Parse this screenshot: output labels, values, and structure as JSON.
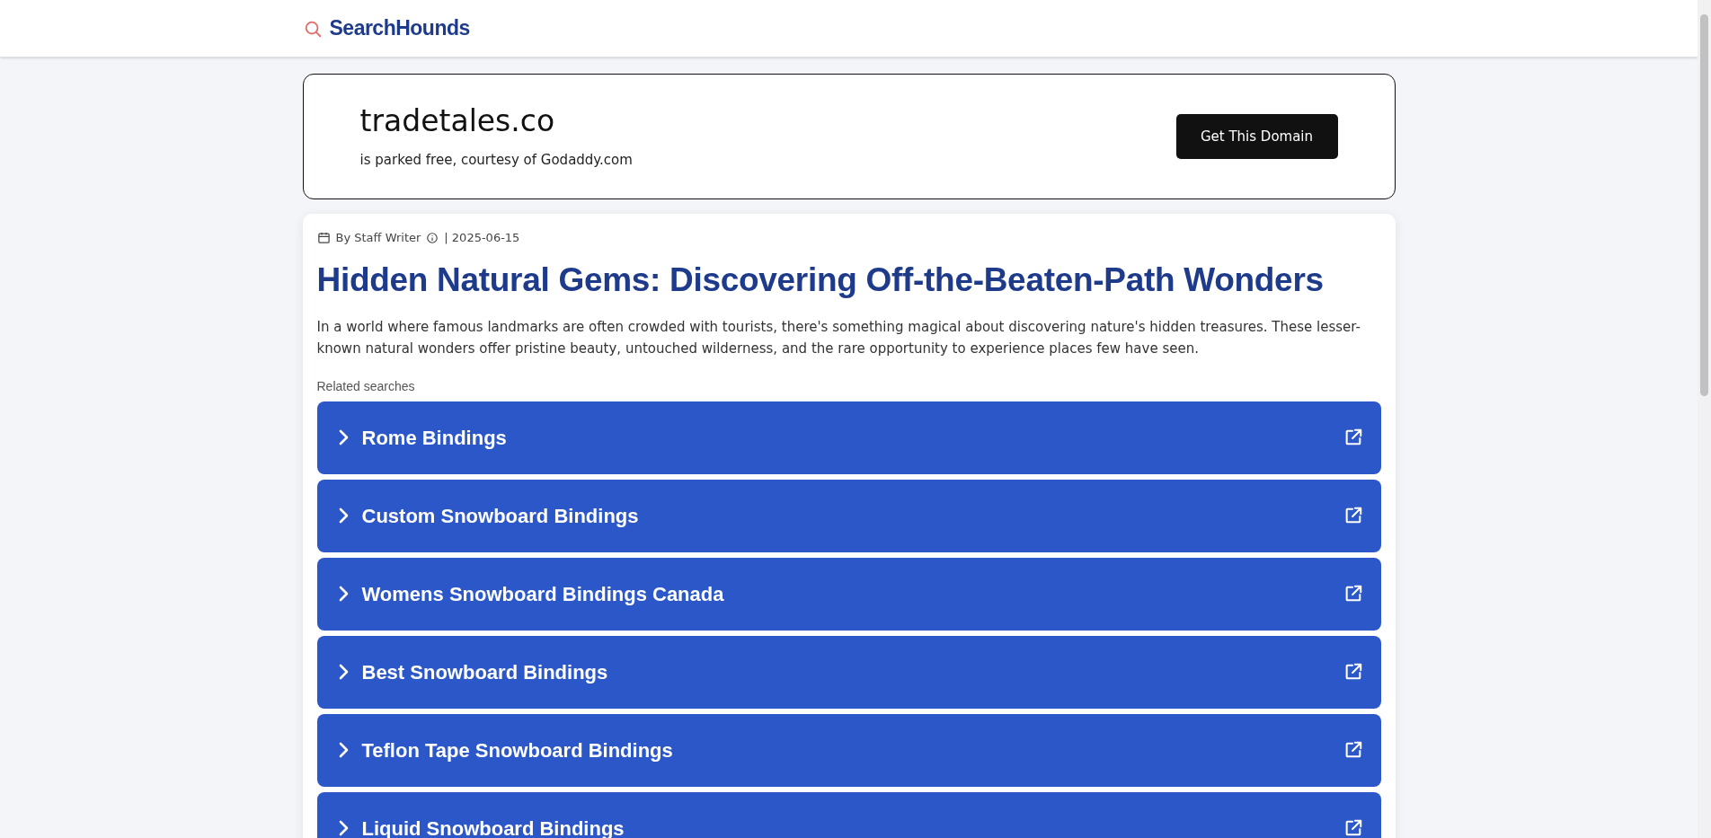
{
  "header": {
    "logo": "SearchHounds"
  },
  "domain_card": {
    "domain": "tradetales.co",
    "subtitle": "is parked free, courtesy of Godaddy.com",
    "button": "Get This Domain"
  },
  "article": {
    "author": "By Staff Writer",
    "date": "| 2025-06-15",
    "title": "Hidden Natural Gems: Discovering Off-the-Beaten-Path Wonders",
    "intro": "In a world where famous landmarks are often crowded with tourists, there's something magical about discovering nature's hidden treasures. These lesser-known natural wonders offer pristine beauty, untouched wilderness, and the rare opportunity to experience places few have seen."
  },
  "related_searches": {
    "label": "Related searches",
    "items": [
      {
        "label": "Rome Bindings"
      },
      {
        "label": "Custom Snowboard Bindings"
      },
      {
        "label": "Womens Snowboard Bindings Canada"
      },
      {
        "label": "Best Snowboard Bindings"
      },
      {
        "label": "Teflon Tape Snowboard Bindings"
      },
      {
        "label": "Liquid Snowboard Bindings"
      }
    ]
  }
}
